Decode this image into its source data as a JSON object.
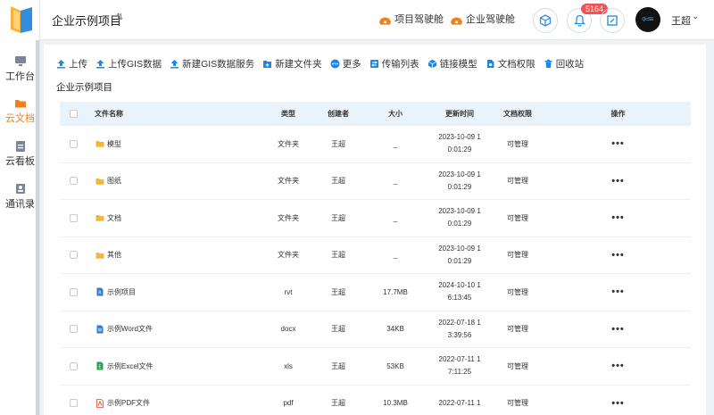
{
  "sidebar": {
    "items": [
      {
        "label": "工作台",
        "icon": "monitor-icon"
      },
      {
        "label": "云文档",
        "icon": "folder-icon",
        "active": true
      },
      {
        "label": "云看板",
        "icon": "clipboard-icon"
      },
      {
        "label": "通讯录",
        "icon": "contact-icon"
      }
    ]
  },
  "header": {
    "project_title": "企业示例项目",
    "cockpit_project": "项目驾驶舱",
    "cockpit_enterprise": "企业驾驶舱",
    "notification_count": "5164",
    "avatar_text": "QcSE",
    "username": "王超"
  },
  "toolbar": {
    "items": [
      {
        "label": "上传",
        "icon": "upload-icon"
      },
      {
        "label": "上传GIS数据",
        "icon": "upload-gis-icon"
      },
      {
        "label": "新建GIS数据服务",
        "icon": "new-gis-service-icon"
      },
      {
        "label": "新建文件夹",
        "icon": "new-folder-icon"
      },
      {
        "label": "更多",
        "icon": "more-icon"
      },
      {
        "label": "传输列表",
        "icon": "transfer-icon"
      },
      {
        "label": "链接模型",
        "icon": "link-model-icon"
      },
      {
        "label": "文档权限",
        "icon": "doc-permission-icon"
      },
      {
        "label": "回收站",
        "icon": "recycle-icon"
      }
    ]
  },
  "breadcrumb": "企业示例项目",
  "table": {
    "headers": {
      "name": "文件名称",
      "type": "类型",
      "creator": "创建者",
      "size": "大小",
      "updated": "更新时间",
      "permission": "文档权限",
      "operation": "操作"
    },
    "rows": [
      {
        "name": "模型",
        "type": "文件夹",
        "creator": "王超",
        "size": "_",
        "time1": "2023-10-09 1",
        "time2": "0:01:29",
        "permission": "可管理",
        "icon": "folder",
        "more": "•••"
      },
      {
        "name": "图纸",
        "type": "文件夹",
        "creator": "王超",
        "size": "_",
        "time1": "2023-10-09 1",
        "time2": "0:01:29",
        "permission": "可管理",
        "icon": "folder",
        "more": "•••"
      },
      {
        "name": "文档",
        "type": "文件夹",
        "creator": "王超",
        "size": "_",
        "time1": "2023-10-09 1",
        "time2": "0:01:29",
        "permission": "可管理",
        "icon": "folder",
        "more": "•••"
      },
      {
        "name": "其他",
        "type": "文件夹",
        "creator": "王超",
        "size": "_",
        "time1": "2023-10-09 1",
        "time2": "0:01:29",
        "permission": "可管理",
        "icon": "folder",
        "more": "•••"
      },
      {
        "name": "示例项目",
        "type": "rvt",
        "creator": "王超",
        "size": "17.7MB",
        "time1": "2024-10-10 1",
        "time2": "6:13:45",
        "permission": "可管理",
        "icon": "rvt",
        "more": "•••"
      },
      {
        "name": "示例Word文件",
        "type": "docx",
        "creator": "王超",
        "size": "34KB",
        "time1": "2022-07-18 1",
        "time2": "3:39:56",
        "permission": "可管理",
        "icon": "word",
        "more": "•••"
      },
      {
        "name": "示例Excel文件",
        "type": "xls",
        "creator": "王超",
        "size": "53KB",
        "time1": "2022-07-11 1",
        "time2": "7:11:25",
        "permission": "可管理",
        "icon": "excel",
        "more": "•••"
      },
      {
        "name": "示例PDF文件",
        "type": "pdf",
        "creator": "王超",
        "size": "10.3MB",
        "time1": "2022-07-11 1",
        "time2": "",
        "permission": "可管理",
        "icon": "pdf",
        "more": "•••"
      }
    ]
  },
  "colors": {
    "accent": "#f0801a",
    "upload_blue": "#1e88e5",
    "folder": "#f5b63c",
    "header_row": "#e9f3fb",
    "word": "#2b7cd3",
    "excel": "#22a355",
    "pdf": "#e5412e",
    "badge": "#f45151"
  }
}
